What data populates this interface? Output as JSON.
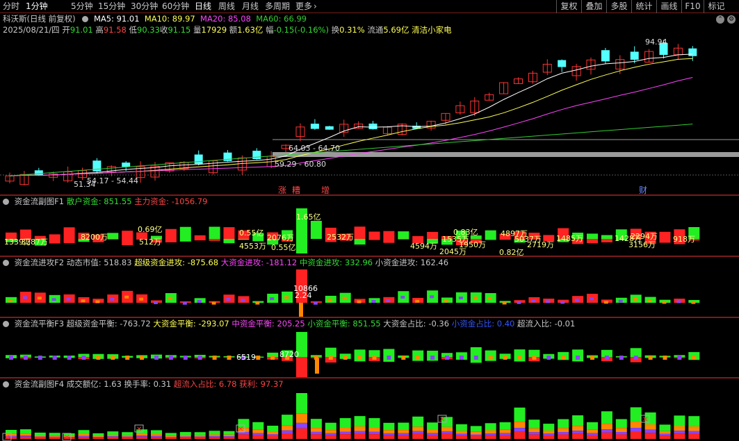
{
  "toolbar": {
    "periods": [
      "分时",
      "1分钟",
      "5分钟",
      "15分钟",
      "30分钟",
      "60分钟",
      "日线",
      "周线",
      "月线",
      "多周期",
      "更多"
    ],
    "active": "日线",
    "right_buttons": [
      "复权",
      "叠加",
      "多股",
      "统计",
      "画线",
      "F10",
      "标记"
    ],
    "more_icon": "chevron-right-icon"
  },
  "main": {
    "title": "科沃斯(日线 前复权)",
    "ma5": "MA5: 91.01",
    "ma10": "MA10: 89.97",
    "ma20": "MA20: 85.08",
    "ma60": "MA60: 66.99",
    "info": {
      "date": "2025/08/21/四",
      "open_label": "开",
      "open": "91.01",
      "high_label": "高",
      "high": "91.58",
      "low_label": "低",
      "low": "90.33",
      "close_label": "收",
      "close": "91.15",
      "vol_label": "量",
      "vol": "17929",
      "amt_label": "额",
      "amt": "1.63亿",
      "chg_label": "幅",
      "chg": "-0.15(-0.16%)",
      "turn_label": "换",
      "turn": "0.31%",
      "float_label": "流通",
      "float": "5.69亿",
      "tag": "清洁小家电"
    },
    "annotations": {
      "high_label": "94.94",
      "low_label": "51.34",
      "range1": "54.17 - 54.44",
      "range2": "64.03 - 64.70",
      "range3": "59.29 - 60.80"
    },
    "markers": [
      "涨",
      "糟",
      "增",
      "财"
    ],
    "colors": {
      "ma5": "#ffffff",
      "ma10": "#ffff55",
      "ma20": "#ff44ff",
      "ma60": "#33cc33",
      "up": "#ff3333",
      "down": "#54ffff"
    }
  },
  "f1": {
    "title": "资金流副图F1",
    "retail_label": "散户资金:",
    "retail": "851.55",
    "main_label": "主力资金:",
    "main": "-1056.79",
    "labels": [
      "1339万",
      "3287万",
      "8200万",
      "0.69亿",
      "0.55亿",
      "2076万",
      "1.65亿",
      "2532万",
      "0.83亿",
      "4897万",
      "1485万",
      "1428万",
      "2294万",
      "918万",
      "4594万",
      "1535万",
      "1950万",
      "5037万",
      "2719万",
      "0.82亿",
      "2045万",
      "3156万",
      "0.55亿",
      "4553万",
      "512万"
    ]
  },
  "f2": {
    "title": "资金流进攻F2",
    "dyn_label": "动态市值:",
    "dyn": "518.83",
    "super_label": "超级资金进攻:",
    "super": "-875.68",
    "big_label": "大资金进攻:",
    "big": "-181.12",
    "mid_label": "中资金进攻:",
    "mid": "332.96",
    "small_label": "小资金进攻:",
    "small": "162.46",
    "labels": [
      "10866",
      "2.24"
    ]
  },
  "f3": {
    "title": "资金流平衡F3",
    "super_label": "超级资金平衡:",
    "super": "-763.72",
    "big_label": "大资金平衡:",
    "big": "-293.07",
    "mid_label": "中资金平衡:",
    "mid": "205.25",
    "small_label": "小资金平衡:",
    "small": "851.55",
    "bigratio_label": "大资金占比:",
    "bigratio": "-0.36",
    "smallratio_label": "小资金占比:",
    "smallratio": "0.40",
    "superin_label": "超流入比:",
    "superin": "-0.01",
    "labels": [
      "6519",
      "8720"
    ]
  },
  "f4": {
    "title": "资金流副图F4",
    "amt_label": "成交额亿:",
    "amt": "1.63",
    "turn_label": "换手率:",
    "turn": "0.31",
    "superin_label": "超流入占比:",
    "superin": "6.78",
    "profit_label": "获利:",
    "profit": "97.37"
  },
  "window": {
    "up_icon": "chevron-up-icon",
    "settings_icon": "gear-icon"
  }
}
